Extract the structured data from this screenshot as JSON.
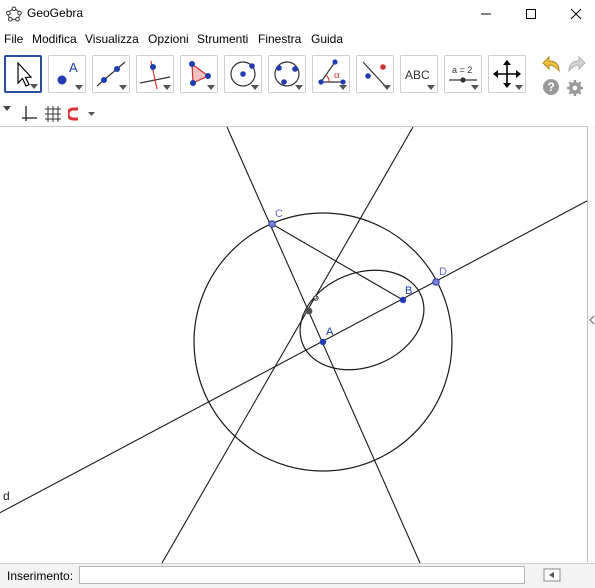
{
  "window": {
    "title": "GeoGebra"
  },
  "menu": [
    "File",
    "Modifica",
    "Visualizza",
    "Opzioni",
    "Strumenti",
    "Finestra",
    "Guida"
  ],
  "toolbar": {
    "tools": [
      {
        "name": "move-tool",
        "icon": "arrow-cursor-icon",
        "selected": true
      },
      {
        "name": "point-tool",
        "icon": "point-icon",
        "label": "A"
      },
      {
        "name": "line-tool",
        "icon": "line-icon"
      },
      {
        "name": "perpendicular-tool",
        "icon": "perpendicular-line-icon"
      },
      {
        "name": "polygon-tool",
        "icon": "polygon-icon"
      },
      {
        "name": "circle-center-tool",
        "icon": "circle-center-icon"
      },
      {
        "name": "circle-three-points-tool",
        "icon": "circle-three-points-icon"
      },
      {
        "name": "angle-tool",
        "icon": "angle-icon",
        "label": "α"
      },
      {
        "name": "reflect-tool",
        "icon": "reflect-icon"
      },
      {
        "name": "text-tool",
        "icon": "text-icon",
        "label": "ABC"
      },
      {
        "name": "slider-tool",
        "icon": "slider-icon",
        "label": "a = 2"
      },
      {
        "name": "move-view-tool",
        "icon": "move-view-icon"
      }
    ],
    "undo_icon": "undo-icon",
    "redo_icon": "redo-icon",
    "help_label": "?",
    "settings_icon": "gear-icon"
  },
  "graphics": {
    "point_labels": {
      "C": "C",
      "D": "D",
      "B": "B",
      "A": "A",
      "P": "P"
    },
    "line_label": "d",
    "colors": {
      "point": "#1f3cb0",
      "point_label": "#6a6ac8",
      "line": "#1a1a1a",
      "center": "#505050"
    }
  },
  "input_bar": {
    "label": "Inserimento:",
    "value": ""
  }
}
